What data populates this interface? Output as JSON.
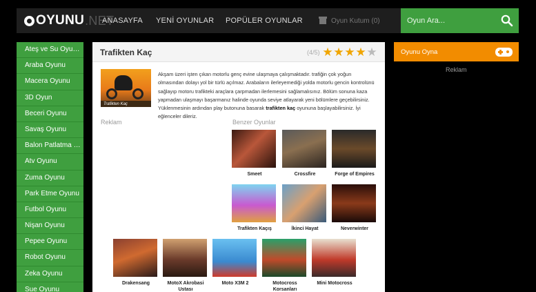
{
  "header": {
    "logo_text": "OYUNU",
    "logo_net": ".NET",
    "nav": [
      "ANASAYFA",
      "YENİ OYUNLAR",
      "POPÜLER OYUNLAR"
    ],
    "collection_label": "Oyun Kutum (0)",
    "search_placeholder": "Oyun Ara..."
  },
  "sidebar": {
    "items": [
      {
        "label": "Ateş ve Su Oyunları"
      },
      {
        "label": "Araba Oyunu"
      },
      {
        "label": "Macera Oyunu"
      },
      {
        "label": "3D Oyun"
      },
      {
        "label": "Beceri Oyunu"
      },
      {
        "label": "Savaş Oyunu"
      },
      {
        "label": "Balon Patlatma Oyunu"
      },
      {
        "label": "Atv Oyunu"
      },
      {
        "label": "Zuma Oyunu"
      },
      {
        "label": "Park Etme Oyunu"
      },
      {
        "label": "Futbol Oyunu"
      },
      {
        "label": "Nişan Oyunu"
      },
      {
        "label": "Pepee Oyunu"
      },
      {
        "label": "Robot Oyunu"
      },
      {
        "label": "Zeka Oyunu"
      },
      {
        "label": "Sue Oyunu"
      }
    ]
  },
  "game": {
    "title": "Trafikten Kaç",
    "rating_text": "(4/5)",
    "rating_value": 4,
    "rating_max": 5,
    "thumb_label": "Trafikten Kaç",
    "description_1": "Akşam üzeri işten çıkan motorlu genç evine ulaşmaya çalışmaktadır. trafiğin çok yoğun olmasından dolayı yol bir türlü açılmaz. Arabaların ilerleyemediği yolda motorlu gencin kontrolünü sağlayıp motoru trafikteki araçlara çarpmadan ilerlemesini sağlamalısınız. Bölüm sonuna kaza yapmadan ulaşmayı başarmanız halinde oyunda seviye atlayarak yeni bölümlere geçebilirsiniz. Yüklenmesinin ardından play butonuna basarak ",
    "description_bold": "trafikten kaç",
    "description_2": " oyununa başlayabilirsiniz. İyi eğlenceler dileriz."
  },
  "labels": {
    "reklam": "Reklam",
    "benzer": "Benzer Oyunlar"
  },
  "similar": [
    {
      "name": "Smeet",
      "icon": "couple-scene"
    },
    {
      "name": "Crossfire",
      "icon": "soldiers"
    },
    {
      "name": "Forge of Empires",
      "icon": "warrior-oyna-badge"
    },
    {
      "name": "Trafikten Kaçış",
      "icon": "motorbike"
    },
    {
      "name": "İkinci Hayat",
      "icon": "couple-beach"
    },
    {
      "name": "Neverwinter",
      "icon": "fantasy-warrior"
    },
    {
      "name": "Drakensang",
      "icon": "armored-knight"
    },
    {
      "name": "MotoX Akrobasi Ustası",
      "icon": "motocross-rider"
    },
    {
      "name": "Moto X3M 2",
      "icon": "stunt-bike"
    },
    {
      "name": "Motocross Korsanları",
      "icon": "pirate-bike"
    },
    {
      "name": "Mini Motocross",
      "icon": "mini-bike"
    }
  ],
  "right": {
    "play_label": "Oyunu Oyna",
    "reklam": "Reklam"
  },
  "colors": {
    "green": "#3f9f3f",
    "orange": "#f28c00",
    "star": "#f0a500"
  }
}
